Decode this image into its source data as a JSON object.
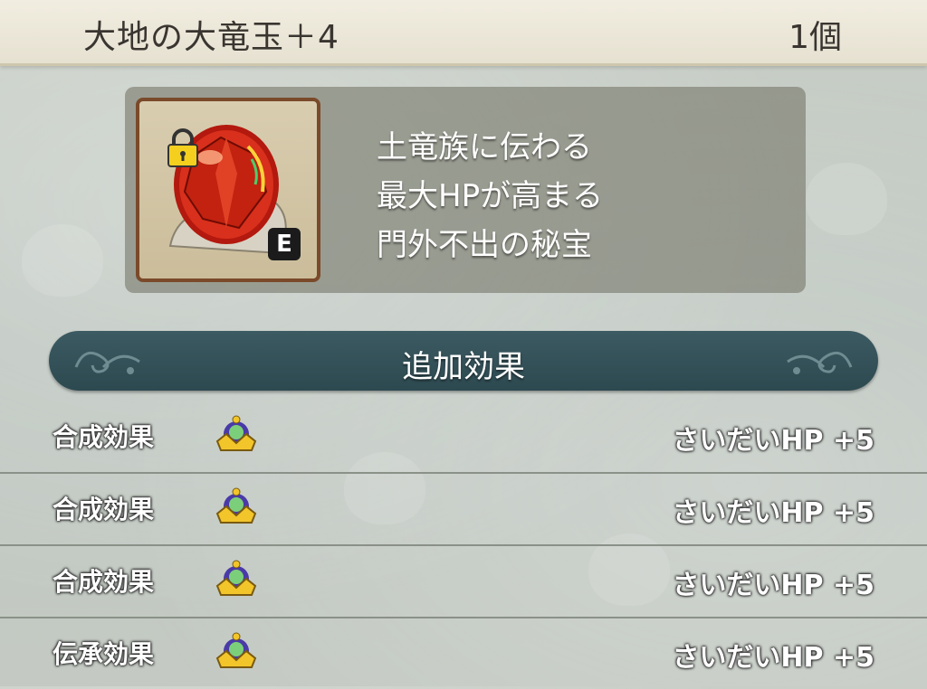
{
  "header": {
    "title": "大地の大竜玉＋4",
    "count": "1個"
  },
  "item": {
    "icon": "dragon-orb-icon",
    "locked": true,
    "equipped_badge": "E",
    "description": [
      "土竜族に伝わる",
      "最大HPが高まる",
      "門外不出の秘宝"
    ]
  },
  "section": {
    "title": "追加効果"
  },
  "effects": [
    {
      "label": "合成効果",
      "icon": "crown-icon",
      "value": "さいだいHP +5"
    },
    {
      "label": "合成効果",
      "icon": "crown-icon",
      "value": "さいだいHP +5"
    },
    {
      "label": "合成効果",
      "icon": "crown-icon",
      "value": "さいだいHP +5"
    },
    {
      "label": "伝承効果",
      "icon": "crown-icon",
      "value": "さいだいHP +5"
    }
  ],
  "colors": {
    "header_bg": "#ece8da",
    "section_bar": "#345159",
    "panel": "#76766a",
    "item_border": "#7a4a2a"
  }
}
